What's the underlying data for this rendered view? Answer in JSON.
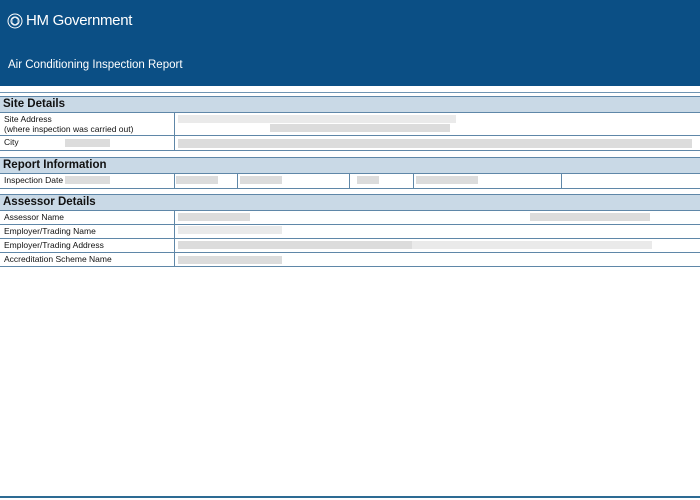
{
  "header": {
    "brand": "HM Government",
    "title": "Air Conditioning Inspection Report"
  },
  "sections": {
    "site_details": {
      "title": "Site Details",
      "site_address_label": "Site Address",
      "site_address_sub": "(where inspection was carried out)",
      "city_label": "City"
    },
    "report_information": {
      "title": "Report Information",
      "inspection_date_label": "Inspection Date"
    },
    "assessor_details": {
      "title": "Assessor Details",
      "assessor_name_label": "Assessor Name",
      "employer_name_label": "Employer/Trading Name",
      "employer_address_label": "Employer/Trading Address",
      "accreditation_label": "Accreditation Scheme Name"
    }
  },
  "colors": {
    "header_bg": "#0b4f85",
    "section_bg": "#c9d9e6",
    "rule": "#5f87a8"
  },
  "icons": {
    "crest": "royal-crest-icon"
  }
}
